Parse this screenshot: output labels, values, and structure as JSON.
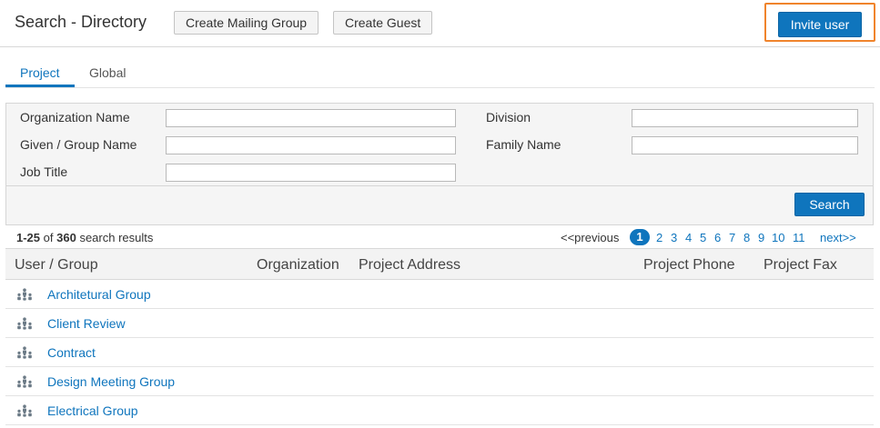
{
  "header": {
    "title": "Search - Directory",
    "create_mailing_group": "Create Mailing Group",
    "create_guest": "Create Guest",
    "invite_user": "Invite user"
  },
  "tabs": [
    {
      "label": "Project",
      "active": true
    },
    {
      "label": "Global",
      "active": false
    }
  ],
  "filters": {
    "organization_name": {
      "label": "Organization Name",
      "value": ""
    },
    "division": {
      "label": "Division",
      "value": ""
    },
    "given_group_name": {
      "label": "Given / Group Name",
      "value": ""
    },
    "family_name": {
      "label": "Family Name",
      "value": ""
    },
    "job_title": {
      "label": "Job Title",
      "value": ""
    },
    "search_label": "Search"
  },
  "results": {
    "range": "1-25",
    "of_word": "of",
    "total": "360",
    "suffix": "search results"
  },
  "pagination": {
    "previous": "<<previous",
    "current": "1",
    "pages": [
      "2",
      "3",
      "4",
      "5",
      "6",
      "7",
      "8",
      "9",
      "10",
      "11"
    ],
    "next": "next>>"
  },
  "table": {
    "columns": [
      "User / Group",
      "Organization",
      "Project Address",
      "Project Phone",
      "Project Fax"
    ],
    "rows": [
      {
        "name": "Architetural Group",
        "icon": "group-icon"
      },
      {
        "name": "Client Review",
        "icon": "group-icon"
      },
      {
        "name": "Contract",
        "icon": "group-icon"
      },
      {
        "name": "Design Meeting Group",
        "icon": "group-icon"
      },
      {
        "name": "Electrical Group",
        "icon": "group-icon"
      }
    ]
  },
  "colors": {
    "accent": "#0f75bd",
    "highlight": "#f0842c"
  }
}
